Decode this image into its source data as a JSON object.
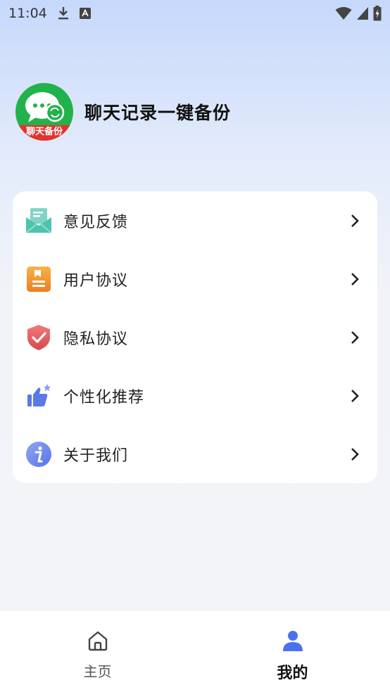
{
  "status_bar": {
    "time": "11:04",
    "icons": [
      "download-icon",
      "font-a-icon",
      "wifi-icon",
      "signal-icon",
      "battery-icon"
    ]
  },
  "profile": {
    "logo_band_text": "聊天备份",
    "app_title": "聊天记录一键备份"
  },
  "menu": {
    "items": [
      {
        "label": "意见反馈",
        "icon": "mail-icon"
      },
      {
        "label": "用户协议",
        "icon": "document-icon"
      },
      {
        "label": "隐私协议",
        "icon": "shield-check-icon"
      },
      {
        "label": "个性化推荐",
        "icon": "thumbs-up-icon"
      },
      {
        "label": "关于我们",
        "icon": "info-icon"
      }
    ]
  },
  "tab_bar": {
    "home_label": "主页",
    "mine_label": "我的",
    "active": "mine",
    "accent_color": "#4a72ee"
  }
}
